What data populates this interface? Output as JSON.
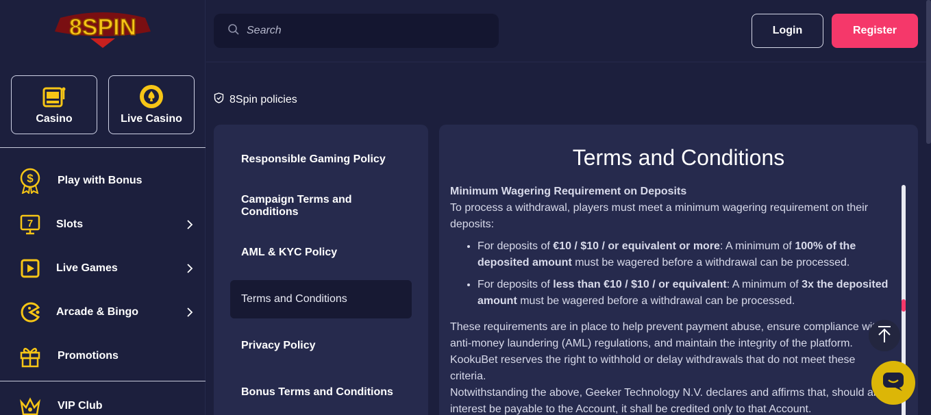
{
  "brand": {
    "logo_text": "8SPIN",
    "accent": "#f5386a",
    "gold": "#f6c516"
  },
  "sidebar": {
    "quick_links": [
      {
        "label": "Casino",
        "icon": "slot-machine-icon"
      },
      {
        "label": "Live Casino",
        "icon": "poker-chip-icon"
      }
    ],
    "items": [
      {
        "label": "Play with Bonus",
        "icon": "bonus-badge-icon",
        "has_chevron": false
      },
      {
        "label": "Slots",
        "icon": "slot-screen-icon",
        "has_chevron": true
      },
      {
        "label": "Live Games",
        "icon": "play-box-icon",
        "has_chevron": true
      },
      {
        "label": "Arcade & Bingo",
        "icon": "pacman-icon",
        "has_chevron": true
      },
      {
        "label": "Promotions",
        "icon": "gift-icon",
        "has_chevron": false
      },
      {
        "label": "VIP Club",
        "icon": "crown-icon",
        "has_chevron": false
      }
    ]
  },
  "header": {
    "search_placeholder": "Search",
    "login_label": "Login",
    "register_label": "Register"
  },
  "breadcrumb": {
    "label": "8Spin policies"
  },
  "policies": [
    {
      "label": "Responsible Gaming Policy",
      "active": false
    },
    {
      "label": "Campaign Terms and Conditions",
      "active": false
    },
    {
      "label": "AML & KYC Policy",
      "active": false
    },
    {
      "label": "Terms and Conditions",
      "active": true
    },
    {
      "label": "Privacy Policy",
      "active": false
    },
    {
      "label": "Bonus Terms and Conditions",
      "active": false
    }
  ],
  "content": {
    "title": "Terms and Conditions",
    "section_heading": "Minimum Wagering Requirement on Deposits",
    "intro": "To process a withdrawal, players must meet a minimum wagering requirement on their deposits:",
    "bullet1": {
      "pre": "For deposits of ",
      "bold1": "€10 / $10 / or equivalent or more",
      "mid": ": A minimum of ",
      "bold2": "100% of the deposited amount",
      "post": " must be wagered before a withdrawal can be processed."
    },
    "bullet2": {
      "pre": "For deposits of ",
      "bold1": "less than €10 / $10 / or equivalent",
      "mid": ": A minimum of ",
      "bold2": "3x the deposited amount",
      "post": " must be wagered before a withdrawal can be processed."
    },
    "para1": "These requirements are in place to help prevent payment abuse, ensure compliance with anti-money laundering (AML) regulations, and maintain the integrity of the platform. KookuBet reserves the right to withhold or delay withdrawals that do not meet these criteria.",
    "para2": "Notwithstanding the above, Geeker Technology N.V. declares and affirms that, should any interest be payable to the Account, it shall be credited only to that Account."
  }
}
